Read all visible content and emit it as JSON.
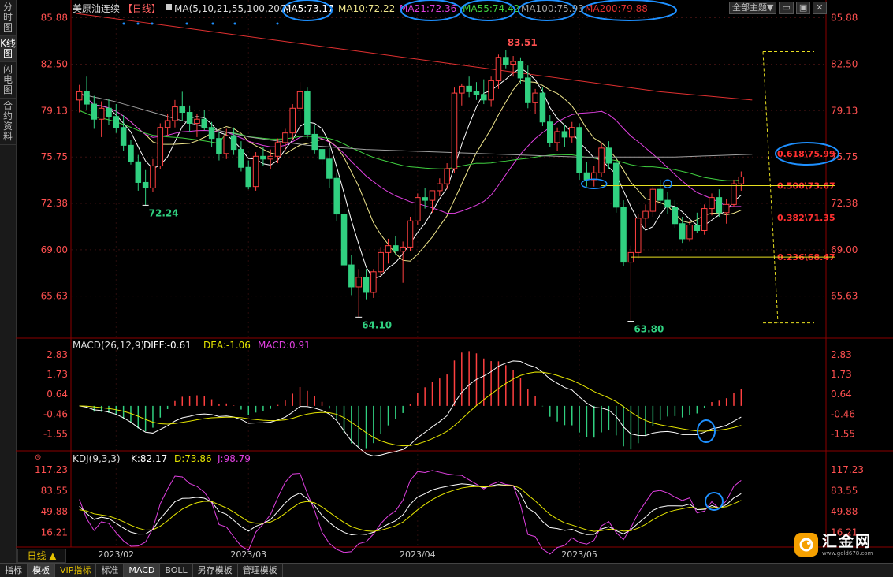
{
  "sidebar": {
    "items": [
      {
        "label": "分时图",
        "active": false
      },
      {
        "label": "K线图",
        "active": true
      },
      {
        "label": "闪电图",
        "active": false
      },
      {
        "label": "合约资料",
        "active": false
      }
    ]
  },
  "header": {
    "symbol": "美原油连续",
    "period_tag": "【日线】",
    "ma_params": "MA(5,10,21,55,100,200)",
    "ma_values": [
      {
        "label": "MA5:73.17",
        "color": "#ffffff"
      },
      {
        "label": "MA10:72.22",
        "color": "#f0e68c"
      },
      {
        "label": "MA21:72.36",
        "color": "#e040e0"
      },
      {
        "label": "MA55:74.42",
        "color": "#40d040"
      },
      {
        "label": "MA100:75.93",
        "color": "#a0a0a0"
      },
      {
        "label": "MA200:79.88",
        "color": "#e03030"
      }
    ],
    "theme_button": "全部主题▼"
  },
  "period_button": "日线 ▲",
  "bottom_tabs": [
    "指标",
    "模板",
    "VIP指标",
    "标准",
    "MACD",
    "BOLL",
    "另存模板",
    "管理模板"
  ],
  "logo": {
    "name": "汇金网",
    "url": "www.gold678.com",
    "color": "#f5a000"
  },
  "colors": {
    "up": "#ff4040",
    "down": "#30d080",
    "fib": "#e8e020",
    "fib_text": "#ff3030",
    "annotation": "#1e90ff"
  },
  "chart_data": [
    {
      "type": "candlestick",
      "name": "main",
      "ylim": [
        62.8,
        86.6
      ],
      "y_ticks": [
        "85.88",
        "82.50",
        "79.13",
        "75.75",
        "72.38",
        "69.00",
        "65.63"
      ],
      "x_ticks": [
        "2023/02",
        "2023/03",
        "2023/04",
        "2023/05"
      ],
      "candles": [
        [
          79.9,
          81.0,
          79.0,
          80.5
        ],
        [
          80.5,
          81.6,
          79.2,
          79.6
        ],
        [
          79.6,
          80.2,
          77.8,
          78.5
        ],
        [
          78.5,
          79.8,
          77.2,
          79.3
        ],
        [
          79.3,
          80.0,
          78.1,
          78.7
        ],
        [
          78.7,
          79.6,
          77.5,
          77.9
        ],
        [
          77.9,
          78.8,
          76.2,
          76.6
        ],
        [
          76.6,
          77.0,
          75.2,
          75.4
        ],
        [
          75.4,
          75.9,
          73.3,
          73.9
        ],
        [
          73.9,
          74.8,
          72.24,
          73.5
        ],
        [
          73.5,
          75.6,
          73.2,
          75.1
        ],
        [
          75.1,
          78.2,
          74.9,
          77.9
        ],
        [
          77.9,
          78.9,
          77.3,
          78.4
        ],
        [
          78.4,
          79.9,
          77.9,
          79.4
        ],
        [
          79.4,
          80.5,
          78.4,
          79.0
        ],
        [
          79.0,
          79.5,
          77.6,
          78.2
        ],
        [
          78.2,
          78.9,
          77.2,
          78.5
        ],
        [
          78.5,
          79.2,
          77.7,
          77.9
        ],
        [
          77.9,
          78.3,
          76.5,
          77.1
        ],
        [
          77.1,
          77.6,
          75.5,
          76.0
        ],
        [
          76.0,
          77.8,
          75.6,
          77.3
        ],
        [
          77.3,
          77.9,
          75.9,
          76.3
        ],
        [
          76.3,
          76.9,
          74.7,
          75.0
        ],
        [
          75.0,
          75.5,
          73.4,
          73.6
        ],
        [
          73.6,
          76.1,
          73.3,
          75.8
        ],
        [
          75.8,
          76.5,
          75.1,
          75.6
        ],
        [
          75.6,
          76.3,
          74.9,
          75.8
        ],
        [
          75.8,
          77.1,
          75.3,
          76.8
        ],
        [
          76.8,
          77.8,
          76.2,
          77.5
        ],
        [
          77.5,
          79.6,
          77.0,
          79.3
        ],
        [
          79.3,
          81.2,
          78.3,
          80.5
        ],
        [
          80.5,
          80.8,
          77.1,
          77.4
        ],
        [
          77.4,
          78.1,
          76.0,
          76.3
        ],
        [
          76.3,
          76.8,
          75.2,
          75.6
        ],
        [
          75.6,
          76.4,
          73.5,
          74.2
        ],
        [
          74.2,
          74.6,
          71.1,
          71.6
        ],
        [
          71.6,
          72.1,
          67.6,
          67.9
        ],
        [
          67.9,
          68.6,
          65.7,
          66.3
        ],
        [
          66.3,
          67.6,
          64.1,
          67.0
        ],
        [
          67.0,
          67.6,
          65.4,
          65.9
        ],
        [
          65.9,
          67.6,
          65.5,
          67.4
        ],
        [
          67.4,
          69.2,
          67.1,
          68.8
        ],
        [
          68.8,
          69.8,
          68.0,
          69.3
        ],
        [
          69.3,
          70.0,
          68.6,
          68.9
        ],
        [
          68.9,
          69.6,
          66.6,
          69.2
        ],
        [
          69.2,
          71.4,
          68.9,
          71.1
        ],
        [
          71.1,
          73.1,
          70.8,
          72.8
        ],
        [
          72.8,
          73.5,
          72.0,
          72.6
        ],
        [
          72.6,
          73.2,
          71.7,
          73.3
        ],
        [
          73.3,
          74.2,
          72.9,
          73.8
        ],
        [
          73.8,
          75.3,
          73.4,
          74.9
        ],
        [
          74.9,
          80.8,
          74.6,
          80.4
        ],
        [
          80.4,
          81.1,
          79.5,
          80.9
        ],
        [
          80.9,
          81.6,
          80.1,
          80.5
        ],
        [
          80.5,
          81.2,
          79.9,
          80.3
        ],
        [
          80.3,
          81.4,
          79.6,
          79.9
        ],
        [
          79.9,
          81.6,
          79.4,
          81.3
        ],
        [
          81.3,
          83.2,
          80.7,
          83.0
        ],
        [
          83.0,
          83.51,
          82.2,
          82.5
        ],
        [
          82.5,
          83.1,
          81.6,
          82.7
        ],
        [
          82.7,
          83.0,
          81.1,
          81.5
        ],
        [
          81.5,
          82.4,
          79.3,
          79.7
        ],
        [
          79.7,
          80.7,
          78.9,
          80.4
        ],
        [
          80.4,
          80.8,
          78.0,
          78.3
        ],
        [
          78.3,
          78.8,
          76.5,
          76.8
        ],
        [
          76.8,
          77.9,
          76.2,
          77.6
        ],
        [
          77.6,
          78.1,
          76.5,
          77.2
        ],
        [
          77.2,
          78.3,
          76.8,
          77.9
        ],
        [
          77.9,
          78.2,
          74.1,
          74.6
        ],
        [
          74.6,
          75.4,
          73.6,
          74.1
        ],
        [
          74.1,
          75.1,
          73.6,
          74.6
        ],
        [
          74.6,
          76.8,
          74.3,
          76.4
        ],
        [
          76.4,
          76.9,
          74.9,
          75.3
        ],
        [
          75.3,
          75.8,
          71.7,
          72.1
        ],
        [
          72.1,
          72.6,
          67.8,
          68.1
        ],
        [
          68.1,
          69.3,
          63.8,
          68.8
        ],
        [
          68.8,
          71.6,
          68.4,
          71.3
        ],
        [
          71.3,
          72.3,
          70.6,
          71.8
        ],
        [
          71.8,
          73.6,
          71.4,
          73.4
        ],
        [
          73.4,
          74.1,
          72.3,
          72.6
        ],
        [
          72.6,
          73.2,
          71.6,
          72.1
        ],
        [
          72.1,
          72.6,
          70.6,
          70.9
        ],
        [
          70.9,
          71.4,
          69.5,
          69.8
        ],
        [
          69.8,
          71.1,
          69.6,
          70.8
        ],
        [
          70.8,
          71.7,
          70.2,
          70.4
        ],
        [
          70.4,
          72.3,
          70.1,
          72.0
        ],
        [
          72.0,
          73.1,
          71.5,
          72.8
        ],
        [
          72.8,
          73.4,
          71.4,
          71.7
        ],
        [
          71.7,
          72.7,
          70.9,
          72.3
        ],
        [
          72.3,
          74.1,
          72.1,
          73.8
        ],
        [
          73.8,
          74.7,
          73.3,
          74.3
        ]
      ],
      "ma_lines": [
        {
          "name": "MA5",
          "color": "#ffffff"
        },
        {
          "name": "MA10",
          "color": "#f0e68c"
        },
        {
          "name": "MA21",
          "color": "#e040e0"
        },
        {
          "name": "MA55",
          "color": "#40d040"
        },
        {
          "name": "MA100",
          "color": "#a0a0a0",
          "values": [
            80.4,
            80.1,
            79.8,
            79.4,
            79.0,
            78.6,
            78.2,
            77.8,
            77.5,
            77.2,
            77.0,
            76.8,
            76.6,
            76.5,
            76.4,
            76.3,
            76.25,
            76.2,
            76.15,
            76.1,
            76.05,
            76.0,
            75.95,
            75.9,
            75.85,
            75.8,
            75.75,
            75.75,
            75.75,
            75.75,
            75.75,
            75.75,
            75.8,
            75.85,
            75.9,
            75.95
          ]
        },
        {
          "name": "MA200",
          "color": "#e03030",
          "values": [
            86.2,
            85.9,
            85.6,
            85.3,
            85.0,
            84.7,
            84.4,
            84.1,
            83.8,
            83.5,
            83.2,
            82.9,
            82.6,
            82.3,
            82.0,
            81.7,
            81.4,
            81.1,
            80.8,
            80.5,
            80.3,
            80.1,
            79.9
          ]
        }
      ],
      "annotations": {
        "high_label": "83.51",
        "lows": [
          "72.24",
          "64.10",
          "63.80"
        ],
        "fib_levels": [
          {
            "label": "0.618\\75.99",
            "value": 75.99,
            "circled": true
          },
          {
            "label": "0.500\\73.67",
            "value": 73.67
          },
          {
            "label": "0.382\\71.35",
            "value": 71.35
          },
          {
            "label": "0.236\\68.47",
            "value": 68.47
          }
        ]
      }
    },
    {
      "type": "macd",
      "name": "MACD",
      "title": "MACD(26,12,9)",
      "readouts": [
        {
          "label": "DIFF:-0.61",
          "color": "#ffffff"
        },
        {
          "label": "DEA:-1.06",
          "color": "#e6e600"
        },
        {
          "label": "MACD:0.91",
          "color": "#e040e0"
        }
      ],
      "ylim": [
        -2.4,
        3.0
      ],
      "y_ticks": [
        "2.83",
        "1.73",
        "0.64",
        "-0.46",
        "-1.55"
      ]
    },
    {
      "type": "kdj",
      "name": "KDJ",
      "title": "KDJ(9,3,3)",
      "readouts": [
        {
          "label": "K:82.17",
          "color": "#ffffff"
        },
        {
          "label": "D:73.86",
          "color": "#e6e600"
        },
        {
          "label": "J:98.79",
          "color": "#e040e0"
        }
      ],
      "ylim": [
        -5,
        125
      ],
      "y_ticks": [
        "117.23",
        "83.55",
        "49.88",
        "16.21"
      ]
    }
  ]
}
